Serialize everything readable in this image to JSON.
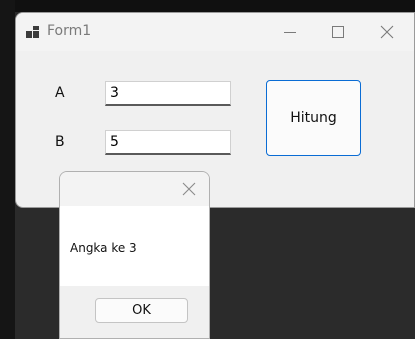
{
  "form": {
    "title": "Form1",
    "label_a": "A",
    "value_a": "3",
    "label_b": "B",
    "value_b": "5",
    "button_label": "Hitung"
  },
  "messagebox": {
    "message": "Angka ke 3",
    "ok_label": "OK"
  },
  "icons": {
    "app": "app-grid-icon",
    "minimize": "minimize-icon",
    "maximize": "maximize-icon",
    "close": "close-icon"
  },
  "colors": {
    "accent": "#0a6cd4"
  }
}
